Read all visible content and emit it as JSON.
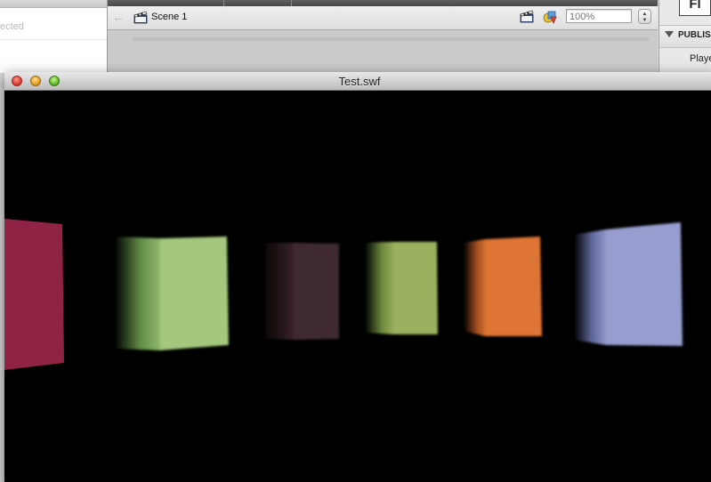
{
  "ide": {
    "left_panel": {
      "partial_text": "ected"
    },
    "edit_bar": {
      "scene_label": "Scene 1",
      "zoom_value": "100%"
    },
    "right_panel": {
      "logo_text": "Fl",
      "section_title": "PUBLISH",
      "player_label": "Playe"
    }
  },
  "window": {
    "title": "Test.swf",
    "buttons": [
      "close",
      "minimize",
      "zoom"
    ]
  },
  "swf_scene": {
    "cubes": [
      {
        "name": "cube-crimson",
        "front_color": "#8e2343",
        "side_color": "#5a1329"
      },
      {
        "name": "cube-light-green",
        "front_color": "#a3c77d",
        "side_color": "#6b8a52"
      },
      {
        "name": "cube-dark-plum",
        "front_color": "#412932",
        "side_color": "#2a1a20"
      },
      {
        "name": "cube-olive-green",
        "front_color": "#9bb05f",
        "side_color": "#6b7d3e"
      },
      {
        "name": "cube-orange",
        "front_color": "#de7535",
        "side_color": "#9a4f22"
      },
      {
        "name": "cube-lavender",
        "front_color": "#979ecf",
        "side_color": "#666ea3"
      }
    ]
  }
}
